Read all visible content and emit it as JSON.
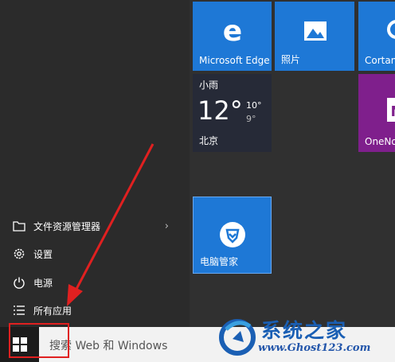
{
  "tiles": {
    "edge_label": "Microsoft Edge",
    "photos_label": "照片",
    "cortana_label": "Cortan",
    "onenote_label": "OneNo",
    "tencent_label": "电脑管家",
    "weather": {
      "condition": "小雨",
      "temp": "12°",
      "high": "10°",
      "low": "9°",
      "city": "北京"
    }
  },
  "menu": {
    "file_explorer": "文件资源管理器",
    "settings": "设置",
    "power": "电源",
    "all_apps": "所有应用"
  },
  "taskbar": {
    "search_placeholder": "搜索 Web 和 Windows"
  },
  "watermark": {
    "title": "系统之家",
    "url": "www.Ghost123.com"
  },
  "colors": {
    "tile_blue": "#1e78d6",
    "annotation_red": "#e02020"
  }
}
